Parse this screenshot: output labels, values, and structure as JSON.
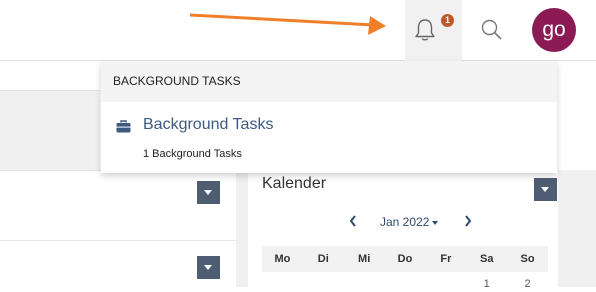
{
  "header": {
    "notification_count": "1",
    "avatar_initials": "go"
  },
  "dropdown": {
    "header_label": "BACKGROUND TASKS",
    "task_title": "Background Tasks",
    "task_subtitle": "1 Background Tasks"
  },
  "calendar": {
    "title": "Kalender",
    "month_label": "Jan 2022",
    "weekdays": [
      "Mo",
      "Di",
      "Mi",
      "Do",
      "Fr",
      "Sa",
      "So"
    ],
    "first_days": [
      "",
      "",
      "",
      "",
      "",
      "1",
      "2"
    ]
  },
  "colors": {
    "accent": "#4f5d73",
    "badge": "#c0582e",
    "avatar": "#8b1a55",
    "arrow": "#f07f2a"
  },
  "icons": [
    "arrow-annotation-icon",
    "bell-icon",
    "search-icon",
    "briefcase-icon",
    "chevron-left-icon",
    "chevron-right-icon",
    "caret-down-icon"
  ]
}
